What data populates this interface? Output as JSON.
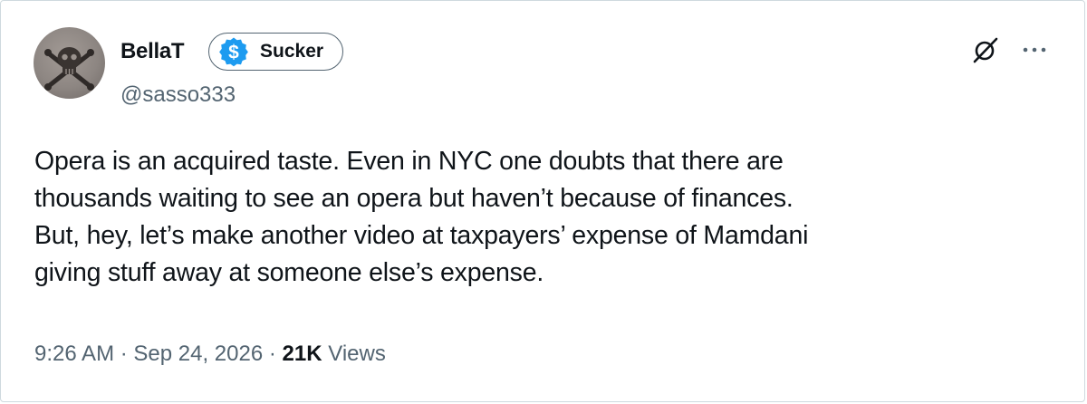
{
  "user": {
    "display_name": "BellaT",
    "handle": "@sasso333",
    "badge": {
      "icon": "dollar-badge-icon",
      "color": "#1d9bf0",
      "label": "Sucker"
    },
    "avatar": {
      "icon": "skull-crossbones-icon"
    }
  },
  "actions": {
    "grok_icon": "grok-icon",
    "more_icon": "more-horizontal-icon"
  },
  "tweet": {
    "lines": [
      "Opera is an acquired taste. Even in NYC one doubts that there are",
      "thousands waiting to see an opera but haven’t because of finances.",
      "But, hey, let’s make another video at taxpayers’ expense of Mamdani",
      "giving stuff away at someone else’s expense."
    ]
  },
  "meta": {
    "time": "9:26 AM",
    "separator": "·",
    "date": "Sep 24, 2026",
    "views_count": "21K",
    "views_label": "Views"
  },
  "colors": {
    "text": "#0f1419",
    "secondary": "#536471",
    "border": "#cfd9de"
  }
}
